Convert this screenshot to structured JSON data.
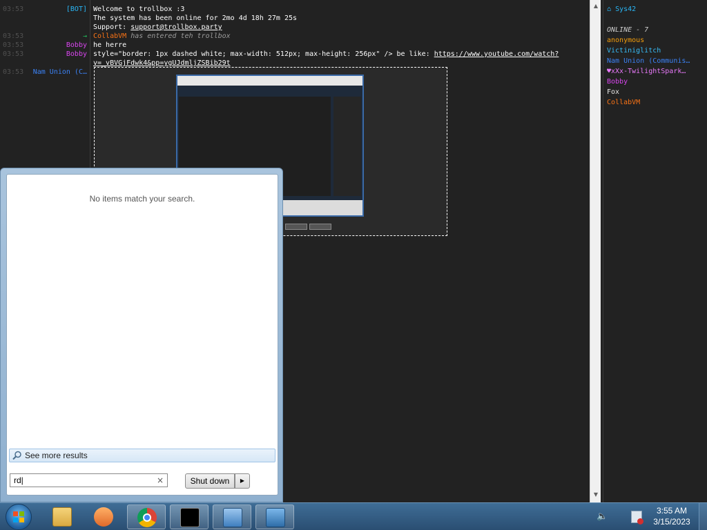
{
  "chat": {
    "messages": [
      {
        "time": "03:53",
        "nick": "[BOT]",
        "nick_color": "#29b6f6",
        "text": "Welcome to trollbox :3"
      },
      {
        "time": "",
        "nick": "",
        "nick_color": "#29b6f6",
        "text": "The system has been online for 2mo 4d 18h 27m 25s"
      },
      {
        "time": "",
        "nick": "",
        "nick_color": "#29b6f6",
        "text_prefix": "Support: ",
        "link": "support@trollbox.party"
      },
      {
        "time": "03:53",
        "nick": "→",
        "nick_color": "#22c55e",
        "user": "CollabVM",
        "user_color": "#f97316",
        "text": "has entered teh trollbox"
      },
      {
        "time": "03:53",
        "nick": "Bobby",
        "nick_color": "#d946ef",
        "text": "he herre"
      },
      {
        "time": "03:53",
        "nick": "Bobby",
        "nick_color": "#d946ef",
        "text_prefix": "style=\"border: 1px dashed white; max-width: 512px; max-height: 256px\"   /> be like: ",
        "link": "https://www.youtube.com/watch?"
      },
      {
        "time": "",
        "nick": "",
        "nick_color": "#d946ef",
        "link": "v=_vBVGjFdwk4&pp=ygUJdmljZSBib29t"
      },
      {
        "time": "03:53",
        "nick": "Nam Union (C…",
        "nick_color": "#3b82f6",
        "text": ""
      }
    ]
  },
  "userlist": {
    "title": "Sys42",
    "title_color": "#29b6f6",
    "online_label": "ONLINE - 7",
    "users": [
      {
        "name": "anonymous",
        "color": "#f59e0b"
      },
      {
        "name": "Victiniglitch",
        "color": "#38bdf8"
      },
      {
        "name": "Nam Union (Communis…",
        "color": "#3b82f6"
      },
      {
        "name": "♥xXx-TwilightSpark…",
        "color": "#e879f9"
      },
      {
        "name": "Bobby",
        "color": "#d946ef"
      },
      {
        "name": "Fox",
        "color": "#e5e5e5"
      },
      {
        "name": "CollabVM",
        "color": "#f97316"
      }
    ]
  },
  "start_menu": {
    "no_items": "No items match your search.",
    "see_more": "See more results",
    "search_value": "rd",
    "shutdown_label": "Shut down"
  },
  "taskbar": {
    "icons": [
      "start-orb-icon",
      "file-explorer-icon",
      "media-player-icon",
      "chrome-icon",
      "command-prompt-icon",
      "network-monitor-icon",
      "remote-desktop-icon"
    ],
    "clock_time": "3:55 AM",
    "clock_date": "3/15/2023"
  }
}
